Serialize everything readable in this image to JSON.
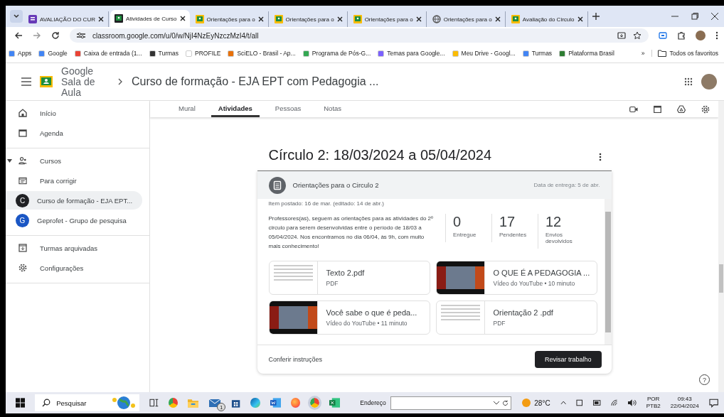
{
  "browser": {
    "tabs": [
      {
        "title": "AVALIAÇÃO DO CUR",
        "kind": "forms",
        "selected": false
      },
      {
        "title": "Atividades de Curso",
        "kind": "classroom",
        "selected": true
      },
      {
        "title": "Orientações para o",
        "kind": "classroom",
        "selected": false
      },
      {
        "title": "Orientações para o",
        "kind": "classroom",
        "selected": false
      },
      {
        "title": "Orientações para o",
        "kind": "classroom",
        "selected": false
      },
      {
        "title": "Orientações para o",
        "kind": "web",
        "selected": false
      },
      {
        "title": "Avaliação do Circulo",
        "kind": "classroom",
        "selected": false
      }
    ],
    "url": "classroom.google.com/u/0/w/NjI4NzEyNzczMzI4/t/all",
    "bookmarks": [
      {
        "label": "Apps",
        "color": "#4285f4"
      },
      {
        "label": "Google",
        "color": "#4285f4"
      },
      {
        "label": "Caixa de entrada (1...",
        "color": "#ea4335"
      },
      {
        "label": "Turmas",
        "color": "#333333"
      },
      {
        "label": "PROFILE",
        "color": "#ffffff"
      },
      {
        "label": "SciELO - Brasil - Ap...",
        "color": "#e8710a"
      },
      {
        "label": "Programa de Pós-G...",
        "color": "#34a853"
      },
      {
        "label": "Temas para Google...",
        "color": "#7b61ff"
      },
      {
        "label": "Meu Drive - Googl...",
        "color": "#fbbc04"
      },
      {
        "label": "Turmas",
        "color": "#4285f4"
      },
      {
        "label": "Plataforma Brasil",
        "color": "#2e7d32"
      }
    ],
    "more": "»",
    "all_bookmarks": "Todos os favoritos"
  },
  "app": {
    "brand": "Google Sala de Aula",
    "breadcrumb": "Curso de formação - EJA EPT com Pedagogia ...",
    "sidebar": [
      [
        {
          "label": "Início",
          "kind": "home",
          "selected": false
        },
        {
          "label": "Agenda",
          "kind": "calendar",
          "selected": false
        }
      ],
      [
        {
          "label": "Cursos",
          "kind": "courses",
          "selected": false,
          "expanded": true
        },
        {
          "label": "Para corrigir",
          "kind": "review",
          "selected": false
        },
        {
          "label": "Curso de formação - EJA EPT...",
          "kind": "course",
          "avatar": "C",
          "color": "#202124",
          "selected": true
        },
        {
          "label": "Geprofet - Grupo de pesquisa",
          "kind": "course",
          "avatar": "G",
          "color": "#1a56c4",
          "selected": false
        }
      ],
      [
        {
          "label": "Turmas arquivadas",
          "kind": "archived",
          "selected": false
        },
        {
          "label": "Configurações",
          "kind": "settings",
          "selected": false
        }
      ]
    ],
    "tabs": [
      {
        "label": "Mural",
        "selected": false
      },
      {
        "label": "Atividades",
        "selected": true
      },
      {
        "label": "Pessoas",
        "selected": false
      },
      {
        "label": "Notas",
        "selected": false
      }
    ],
    "topic": "Círculo 2: 18/03/2024 a 05/04/2024",
    "assignment": {
      "title": "Orientações para o Circulo 2",
      "due": "Data de entrega: 5 de abr.",
      "posted": "Item postado: 16 de mar. (editado: 14 de abr.)",
      "description": "Professores(as), seguem as orientações para as atividades do 2º circulo para serem desenvolvidas entre o período de 18/03 a 05/04/2024. Nos encontramos no dia 06/04, às 9h, com muito mais conhecimento!",
      "stats": [
        {
          "value": "0",
          "label": "Entregue"
        },
        {
          "value": "17",
          "label": "Pendentes"
        },
        {
          "value": "12",
          "label": "Envios devolvidos"
        }
      ],
      "attachments": [
        {
          "kind": "pdf",
          "title": "Texto 2.pdf",
          "subtitle": "PDF"
        },
        {
          "kind": "video",
          "title": "O QUE É A PEDAGOGIA ...",
          "subtitle": "Vídeo do YouTube • 10 minuto"
        },
        {
          "kind": "video",
          "title": "Você sabe o que é peda...",
          "subtitle": "Vídeo do YouTube • 11 minuto"
        },
        {
          "kind": "pdf",
          "title": "Orientação 2 .pdf",
          "subtitle": "PDF"
        }
      ],
      "link": "Conferir instruções",
      "button": "Revisar trabalho"
    },
    "help": "?"
  },
  "taskbar": {
    "search": "Pesquisar",
    "mail_badge": "1",
    "address": "Endereço",
    "temperature": "28°C",
    "language": "POR",
    "layout": "PTB2",
    "time": "09:43",
    "date": "22/04/2024"
  }
}
